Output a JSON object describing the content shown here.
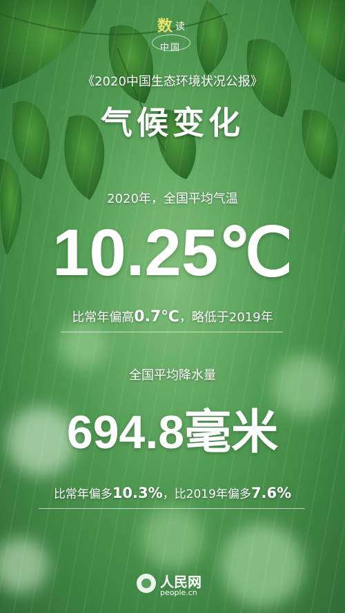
{
  "logo": {
    "char1": "数",
    "char2": "读",
    "char3": "中国"
  },
  "report_title": "《2020中国生态环境状况公报》",
  "section_title": "气候变化",
  "temperature": {
    "label": "2020年，全国平均气温",
    "value": "10.25℃",
    "compare_prefix": "比常年偏高",
    "compare_value": "0.7℃",
    "compare_suffix": "，略低于2019年"
  },
  "precipitation": {
    "label": "全国平均降水量",
    "value": "694.8毫米",
    "compare_prefix": "比常年偏多",
    "compare_value1": "10.3%",
    "compare_mid": "，比2019年偏多",
    "compare_value2": "7.6%"
  },
  "footer": {
    "brand": "人民网",
    "domain": "people.cn"
  },
  "colors": {
    "logo_accent": "#e7e36f",
    "text": "#ffffff",
    "background": "#4f9a52"
  }
}
